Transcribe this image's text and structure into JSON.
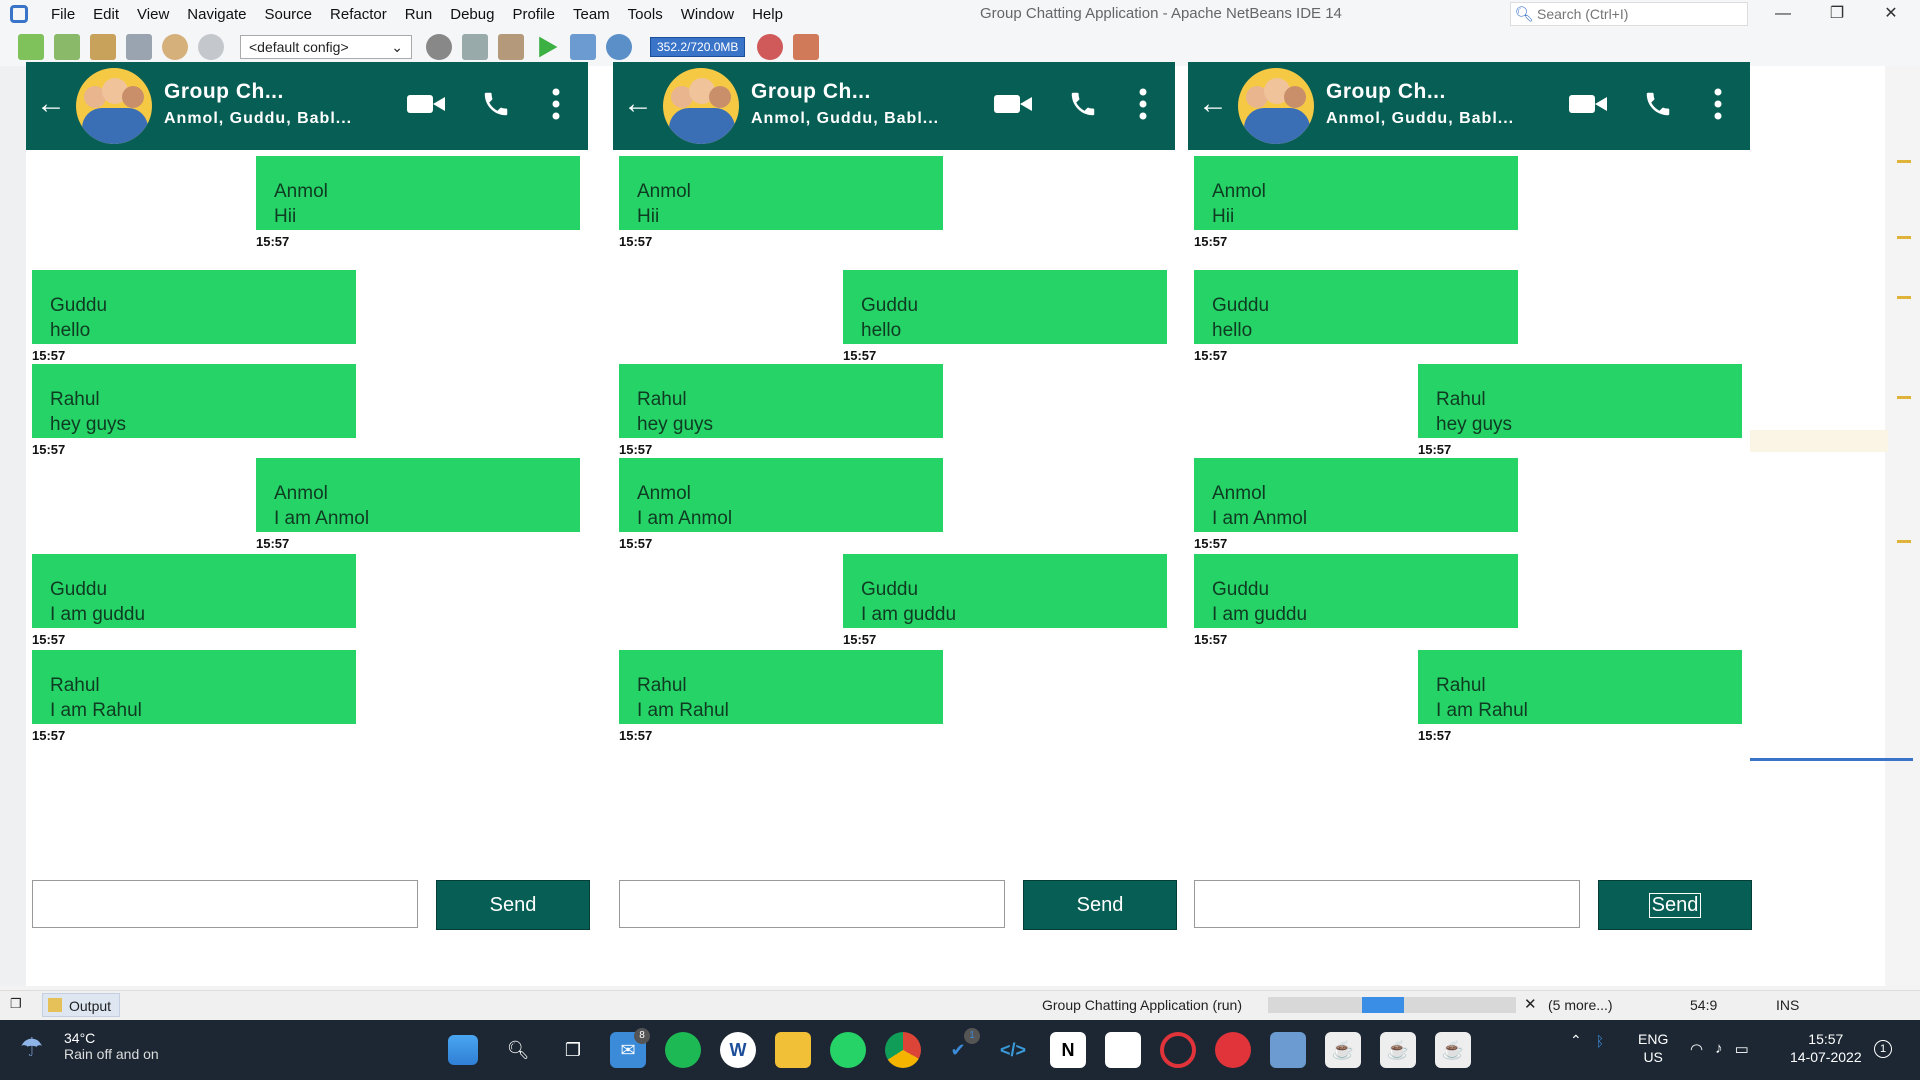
{
  "ide": {
    "menu": [
      "File",
      "Edit",
      "View",
      "Navigate",
      "Source",
      "Refactor",
      "Run",
      "Debug",
      "Profile",
      "Team",
      "Tools",
      "Window",
      "Help"
    ],
    "window_title": "Group Chatting Application - Apache NetBeans IDE 14",
    "search_placeholder": "Search (Ctrl+I)",
    "config": "<default config>",
    "memory": "352.2/720.0MB",
    "status": {
      "output_tab": "Output",
      "run_name": "Group Chatting Application (run)",
      "progress_fraction": 0.6,
      "more": "(5 more...)",
      "position": "54:9",
      "mode": "INS"
    }
  },
  "chats": [
    {
      "title": "Group Ch...",
      "members": "Anmol, Guddu, Babl...",
      "send_label": "Send",
      "messages": [
        {
          "sender": "Anmol",
          "text": "Hii",
          "time": "15:57",
          "side": "right"
        },
        {
          "sender": "Guddu",
          "text": "hello",
          "time": "15:57",
          "side": "left"
        },
        {
          "sender": "Rahul",
          "text": "hey guys",
          "time": "15:57",
          "side": "left"
        },
        {
          "sender": "Anmol",
          "text": "I am Anmol",
          "time": "15:57",
          "side": "right"
        },
        {
          "sender": "Guddu",
          "text": "I am guddu",
          "time": "15:57",
          "side": "left"
        },
        {
          "sender": "Rahul",
          "text": "I am Rahul",
          "time": "15:57",
          "side": "left"
        }
      ]
    },
    {
      "title": "Group Ch...",
      "members": "Anmol, Guddu, Babl...",
      "send_label": "Send",
      "messages": [
        {
          "sender": "Anmol",
          "text": "Hii",
          "time": "15:57",
          "side": "left"
        },
        {
          "sender": "Guddu",
          "text": "hello",
          "time": "15:57",
          "side": "right"
        },
        {
          "sender": "Rahul",
          "text": "hey guys",
          "time": "15:57",
          "side": "left"
        },
        {
          "sender": "Anmol",
          "text": "I am Anmol",
          "time": "15:57",
          "side": "left"
        },
        {
          "sender": "Guddu",
          "text": "I am guddu",
          "time": "15:57",
          "side": "right"
        },
        {
          "sender": "Rahul",
          "text": "I am Rahul",
          "time": "15:57",
          "side": "left"
        }
      ]
    },
    {
      "title": "Group Ch...",
      "members": "Anmol, Guddu, Babl...",
      "send_label": "Send",
      "messages": [
        {
          "sender": "Anmol",
          "text": "Hii",
          "time": "15:57",
          "side": "left"
        },
        {
          "sender": "Guddu",
          "text": "hello",
          "time": "15:57",
          "side": "left"
        },
        {
          "sender": "Rahul",
          "text": "hey guys",
          "time": "15:57",
          "side": "right"
        },
        {
          "sender": "Anmol",
          "text": "I am Anmol",
          "time": "15:57",
          "side": "left"
        },
        {
          "sender": "Guddu",
          "text": "I am guddu",
          "time": "15:57",
          "side": "left"
        },
        {
          "sender": "Rahul",
          "text": "I am Rahul",
          "time": "15:57",
          "side": "right"
        }
      ]
    }
  ],
  "taskbar": {
    "weather_temp": "34°C",
    "weather_desc": "Rain off and on",
    "mail_badge": "8",
    "app_badge": "1",
    "lang": "ENG",
    "region": "US",
    "time": "15:57",
    "date": "14-07-2022",
    "notif": "1"
  },
  "colors": {
    "header": "#075e54",
    "bubble": "#25d366",
    "send": "#075e54"
  }
}
